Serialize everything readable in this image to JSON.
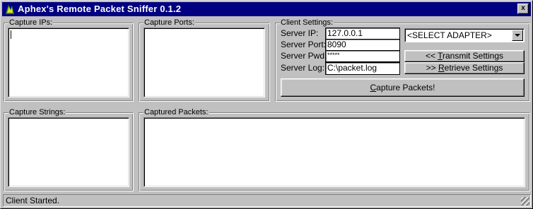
{
  "window": {
    "title": "Aphex's Remote Packet Sniffer 0.1.2",
    "close_label": "x"
  },
  "capture_ips": {
    "label": "Capture IPs:",
    "value": ""
  },
  "capture_ports": {
    "label": "Capture Ports:",
    "value": ""
  },
  "client_settings": {
    "label": "Client Settings:",
    "fields": [
      {
        "label": "Server IP:",
        "value": "127.0.0.1"
      },
      {
        "label": "Server Port:",
        "value": "8090"
      },
      {
        "label": "Server Pwd:",
        "value": "*****"
      },
      {
        "label": "Server Log:",
        "value": "C:\\packet.log"
      }
    ],
    "adapter_select": {
      "value": "<SELECT ADAPTER>"
    },
    "transmit_button": {
      "prefix": "<< ",
      "mnemonic": "T",
      "rest": "ransmit Settings"
    },
    "retrieve_button": {
      "prefix": ">> ",
      "mnemonic": "R",
      "rest": "etrieve Settings"
    },
    "capture_button": {
      "prefix": "",
      "mnemonic": "C",
      "rest": "apture Packets!"
    }
  },
  "capture_strings": {
    "label": "Capture Strings:",
    "value": ""
  },
  "captured_packets": {
    "label": "Captured Packets:",
    "value": ""
  },
  "status": {
    "text": "Client Started."
  }
}
